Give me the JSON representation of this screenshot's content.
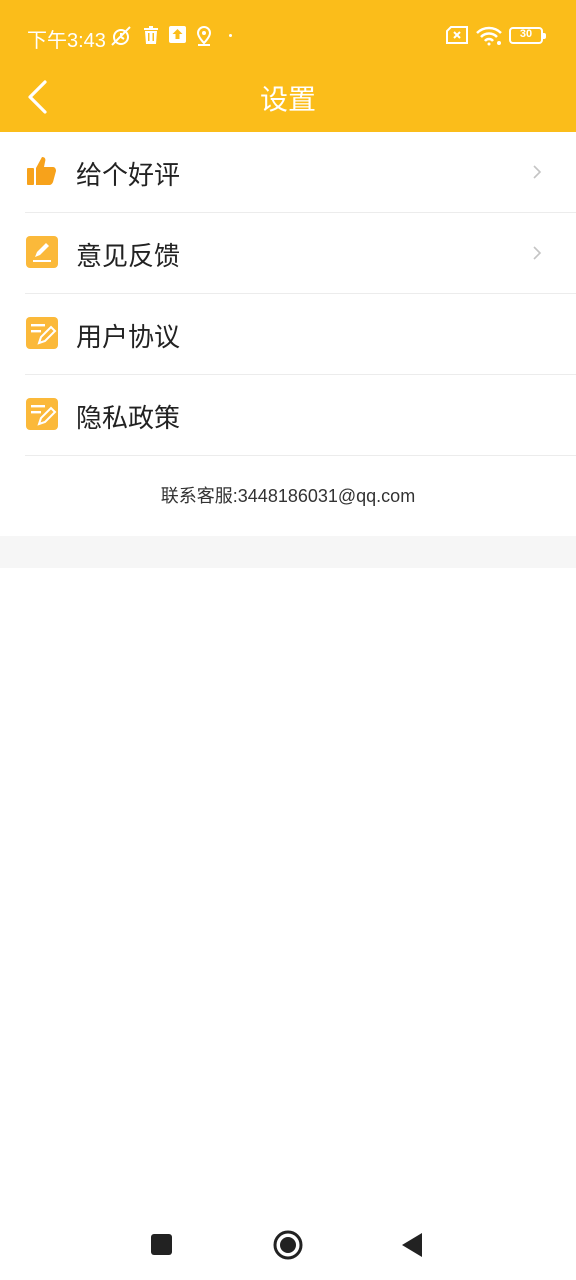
{
  "status_bar": {
    "time": "下午3:43",
    "battery": "30",
    "icons": [
      "muted-alarm-icon",
      "trash-icon",
      "upload-icon",
      "location-icon",
      "sim-error-icon",
      "wifi-icon",
      "battery-icon"
    ]
  },
  "header": {
    "title": "设置",
    "back_icon": "chevron-left-icon",
    "background": "#FBBD1A"
  },
  "menu": {
    "items": [
      {
        "label": "给个好评",
        "icon": "thumbs-up-icon",
        "has_chevron": true
      },
      {
        "label": "意见反馈",
        "icon": "edit-note-icon",
        "has_chevron": true
      },
      {
        "label": "用户协议",
        "icon": "document-pen-icon",
        "has_chevron": false
      },
      {
        "label": "隐私政策",
        "icon": "document-pen-icon",
        "has_chevron": false
      }
    ]
  },
  "contact": "联系客服:3448186031@qq.com",
  "system_nav": {
    "icons": [
      "recents-icon",
      "home-icon",
      "back-icon"
    ]
  }
}
